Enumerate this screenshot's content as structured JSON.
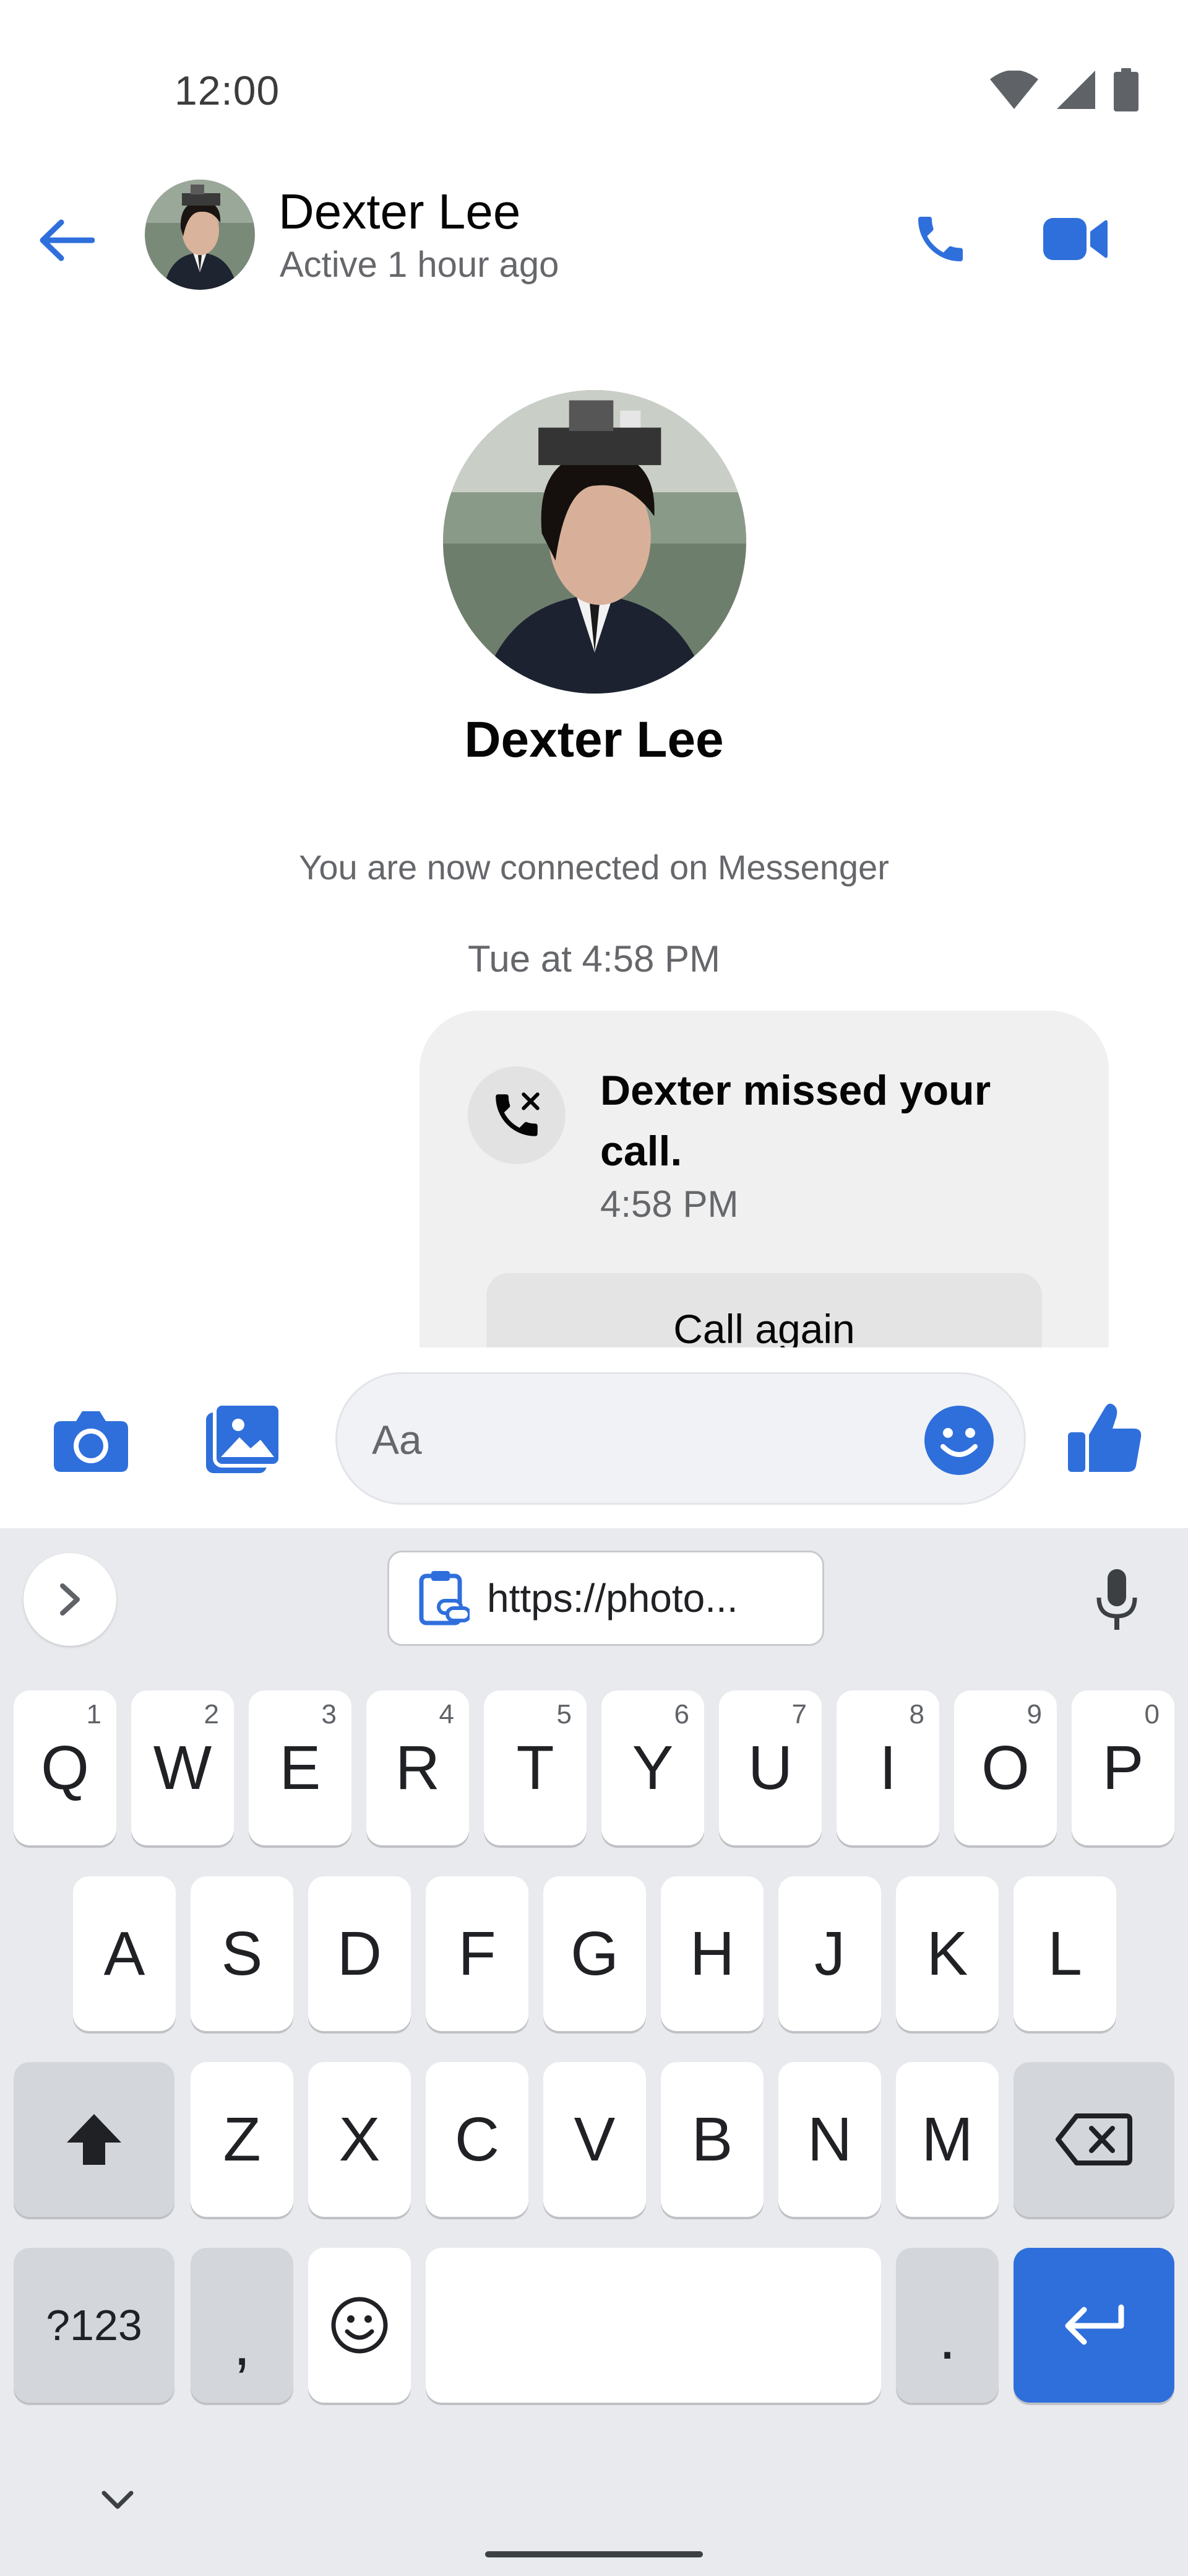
{
  "status_bar": {
    "time": "12:00",
    "icons": [
      "wifi-icon",
      "cellular-signal-icon",
      "battery-icon"
    ]
  },
  "header": {
    "contact_name": "Dexter Lee",
    "contact_status": "Active 1 hour ago",
    "icons": [
      "back-arrow-icon",
      "phone-icon",
      "video-camera-icon"
    ]
  },
  "conversation": {
    "profile_name": "Dexter Lee",
    "connected_text": "You are now connected on Messenger",
    "timestamp": "Tue at 4:58 PM",
    "missed_call": {
      "title": "Dexter missed your call.",
      "time": "4:58 PM",
      "button_label": "Call again",
      "icon": "missed-call-icon"
    }
  },
  "composer": {
    "placeholder": "Aa",
    "value": "",
    "icons": [
      "camera-icon",
      "gallery-icon",
      "emoji-icon",
      "thumbs-up-icon"
    ]
  },
  "keyboard": {
    "clipboard_text": "https://photo...",
    "rows": [
      [
        {
          "label": "Q",
          "hint": "1"
        },
        {
          "label": "W",
          "hint": "2"
        },
        {
          "label": "E",
          "hint": "3"
        },
        {
          "label": "R",
          "hint": "4"
        },
        {
          "label": "T",
          "hint": "5"
        },
        {
          "label": "Y",
          "hint": "6"
        },
        {
          "label": "U",
          "hint": "7"
        },
        {
          "label": "I",
          "hint": "8"
        },
        {
          "label": "O",
          "hint": "9"
        },
        {
          "label": "P",
          "hint": "0"
        }
      ],
      [
        {
          "label": "A"
        },
        {
          "label": "S"
        },
        {
          "label": "D"
        },
        {
          "label": "F"
        },
        {
          "label": "G"
        },
        {
          "label": "H"
        },
        {
          "label": "J"
        },
        {
          "label": "K"
        },
        {
          "label": "L"
        }
      ],
      [
        {
          "label": "Z"
        },
        {
          "label": "X"
        },
        {
          "label": "C"
        },
        {
          "label": "V"
        },
        {
          "label": "B"
        },
        {
          "label": "N"
        },
        {
          "label": "M"
        }
      ]
    ],
    "symbols_label": "?123",
    "comma_label": ",",
    "period_label": ".",
    "icons": [
      "chevron-right-icon",
      "clipboard-link-icon",
      "microphone-icon",
      "shift-icon",
      "backspace-icon",
      "emoji-icon",
      "enter-icon",
      "chevron-down-icon"
    ]
  },
  "colors": {
    "accent": "#2f6fdc",
    "secondary_text": "#65676b",
    "keyboard_bg": "#e8eaed",
    "card_bg": "#f0f0f0"
  }
}
